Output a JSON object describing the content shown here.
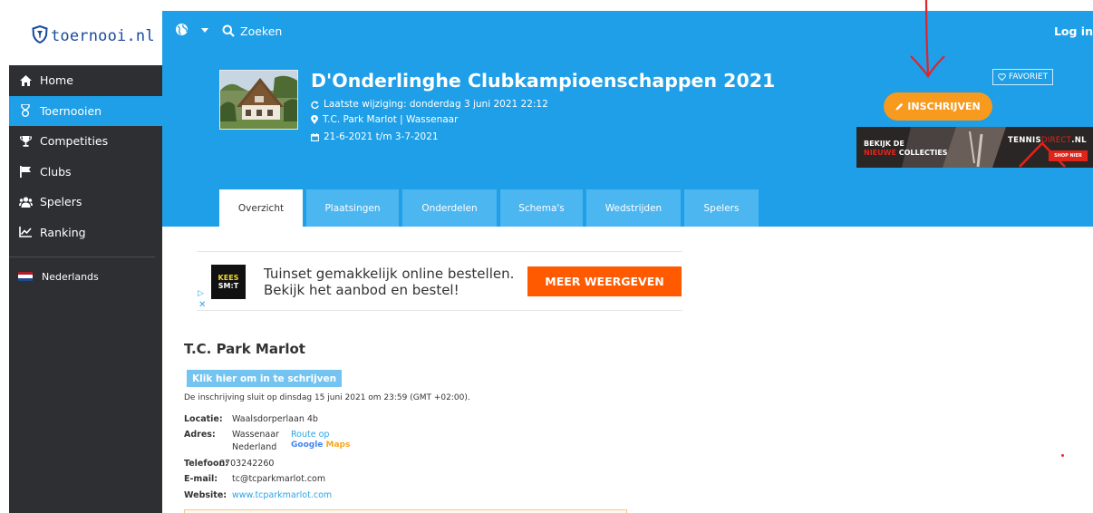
{
  "brand": {
    "logo_text": "toernooi.nl"
  },
  "sidebar": {
    "items": [
      {
        "label": "Home",
        "icon": "home-icon"
      },
      {
        "label": "Toernooien",
        "icon": "trophy-badge-icon",
        "active": true
      },
      {
        "label": "Competities",
        "icon": "cup-icon"
      },
      {
        "label": "Clubs",
        "icon": "flag-icon"
      },
      {
        "label": "Spelers",
        "icon": "users-icon"
      },
      {
        "label": "Ranking",
        "icon": "chart-line-icon"
      }
    ],
    "language": "Nederlands"
  },
  "topbar": {
    "search_label": "Zoeken",
    "login_label": "Log in"
  },
  "tournament": {
    "title": "D'Onderlinghe Clubkampioenschappen 2021",
    "last_modified": "Laatste wijziging: donderdag 3 juni 2021 22:12",
    "location": "T.C. Park Marlot | Wassenaar",
    "dates": "21-6-2021 t/m 3-7-2021"
  },
  "actions": {
    "favorite_label": "FAVORIET",
    "register_label": "INSCHRIJVEN"
  },
  "banner": {
    "line1": "BEKIJK DE",
    "line2_red": "NIEUWE",
    "line2_white": " COLLECTIES",
    "brand_white": "TENNIS",
    "brand_red": "DIRECT",
    "brand_suffix": ".NL",
    "shop_label": "SHOP NIER"
  },
  "tabs": [
    {
      "label": "Overzicht",
      "active": true
    },
    {
      "label": "Plaatsingen"
    },
    {
      "label": "Onderdelen"
    },
    {
      "label": "Schema's"
    },
    {
      "label": "Wedstrijden"
    },
    {
      "label": "Spelers"
    }
  ],
  "ad": {
    "logo_line1": "KEES",
    "logo_line2": "SM:T",
    "line1": "Tuinset gemakkelijk online bestellen.",
    "line2": "Bekijk het aanbod en bestel!",
    "cta": "MEER WEERGEVEN"
  },
  "venue": {
    "name": "T.C. Park Marlot",
    "register_link": "Klik hier om in te schrijven",
    "closing_text": "De inschrijving sluit op dinsdag 15 juni 2021 om 23:59 (GMT +02:00).",
    "location_label": "Locatie:",
    "location_value": "Waalsdorperlaan 4b",
    "address_label": "Adres:",
    "address_line1": "Wassenaar",
    "address_line2": "Nederland",
    "route_label": "Route op",
    "maps_google": "Google",
    "maps_maps": "Maps",
    "phone_label": "Telefoon:",
    "phone_value": "0703242260",
    "email_label": "E-mail:",
    "email_value": "tc@tcparkmarlot.com",
    "website_label": "Website:",
    "website_value": "www.tcparkmarlot.com"
  },
  "colors": {
    "primary": "#1e9fe7",
    "sidebar_bg": "#2d2f33",
    "accent_orange": "#f79a1e",
    "annotation_red": "#e0242a"
  }
}
